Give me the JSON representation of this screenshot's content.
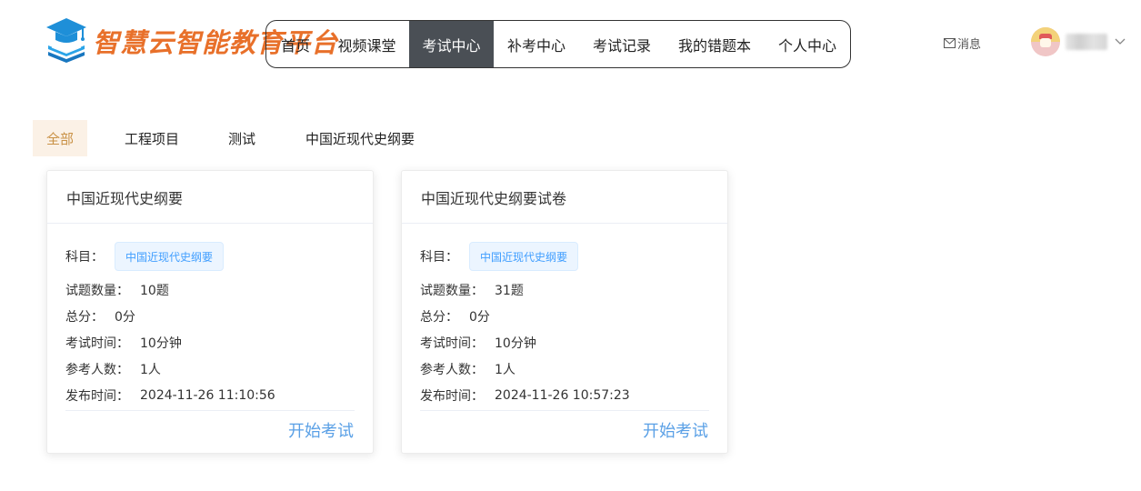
{
  "header": {
    "logo_text": "智慧云智能教育平台",
    "message_label": "消息",
    "nav": [
      {
        "label": "首页",
        "active": false
      },
      {
        "label": "视频课堂",
        "active": false
      },
      {
        "label": "考试中心",
        "active": true
      },
      {
        "label": "补考中心",
        "active": false
      },
      {
        "label": "考试记录",
        "active": false
      },
      {
        "label": "我的错题本",
        "active": false
      },
      {
        "label": "个人中心",
        "active": false
      }
    ]
  },
  "categories": [
    {
      "label": "全部",
      "active": true
    },
    {
      "label": "工程项目",
      "active": false
    },
    {
      "label": "测试",
      "active": false
    },
    {
      "label": "中国近现代史纲要",
      "active": false
    }
  ],
  "labels": {
    "subject": "科目：",
    "question_count": "试题数量：",
    "total_score": "总分：",
    "exam_time": "考试时间：",
    "participants": "参考人数：",
    "publish_time": "发布时间：",
    "start_button": "开始考试"
  },
  "exams": [
    {
      "title": "中国近现代史纲要",
      "subject": "中国近现代史纲要",
      "question_count": "10题",
      "total_score": "0分",
      "exam_time": "10分钟",
      "participants": "1人",
      "publish_time": "2024-11-26 11:10:56"
    },
    {
      "title": "中国近现代史纲要试卷",
      "subject": "中国近现代史纲要",
      "question_count": "31题",
      "total_score": "0分",
      "exam_time": "10分钟",
      "participants": "1人",
      "publish_time": "2024-11-26 10:57:23"
    }
  ],
  "colors": {
    "logo": "#e8702a",
    "nav_active_bg": "#4a4f55",
    "category_active_bg": "#fbf1e6",
    "category_active_text": "#c99145",
    "tag_text": "#409eff",
    "start_button": "#5aa0e6"
  }
}
